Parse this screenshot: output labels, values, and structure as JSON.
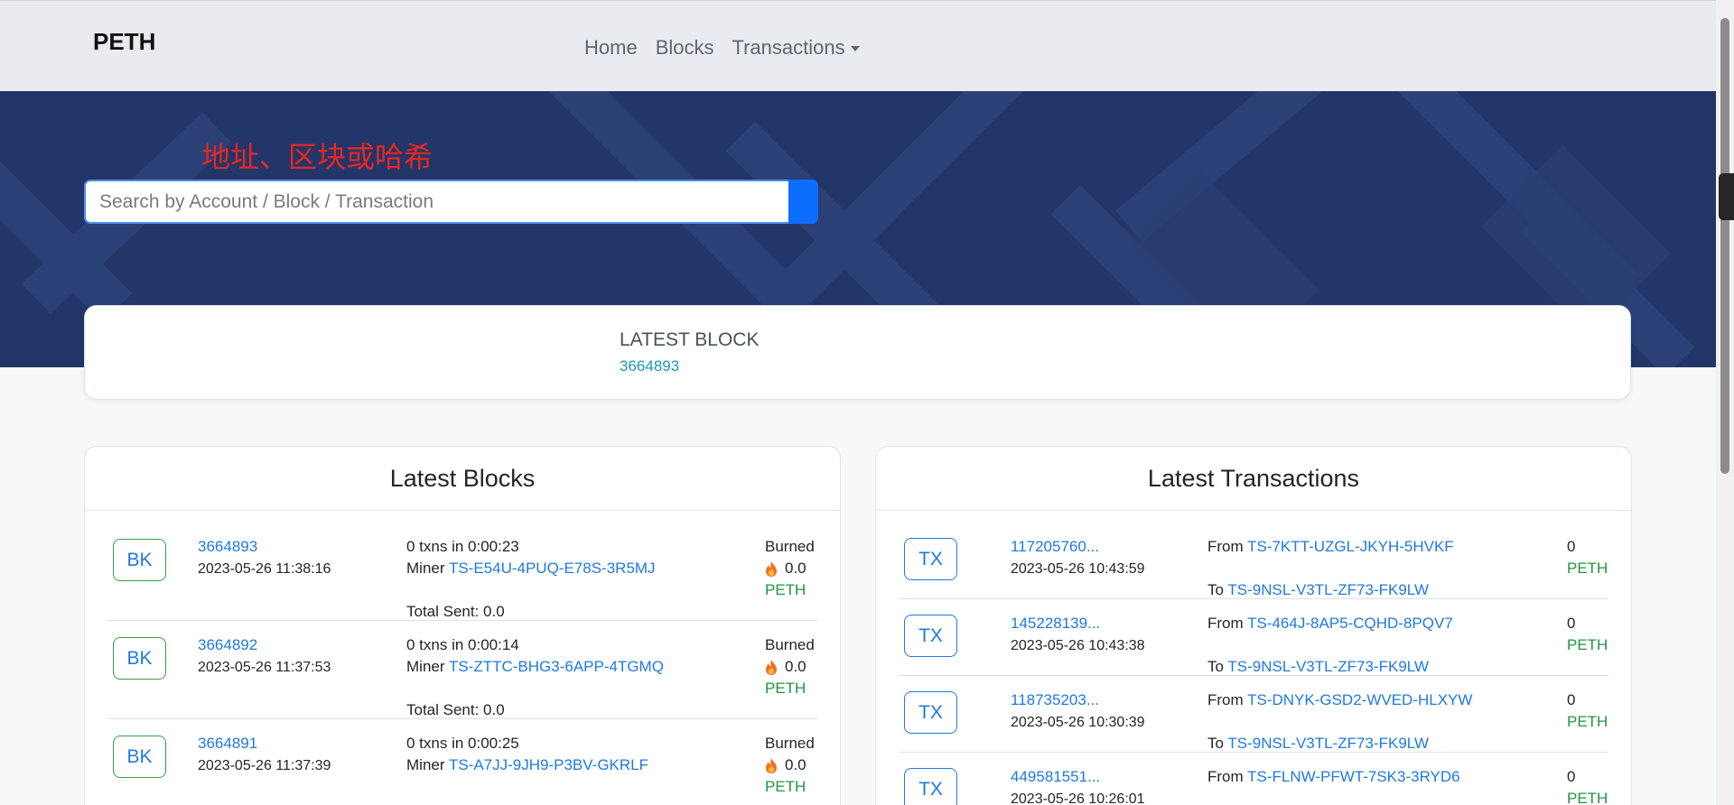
{
  "navbar": {
    "brand": "PETH",
    "links": [
      {
        "label": "Home"
      },
      {
        "label": "Blocks"
      },
      {
        "label": "Transactions"
      }
    ]
  },
  "hero": {
    "note": "地址、区块或哈希",
    "search_placeholder": "Search by Account / Block / Transaction"
  },
  "summary": {
    "label": "LATEST BLOCK",
    "value": "3664893"
  },
  "blocks_panel": {
    "title": "Latest Blocks",
    "badge": "BK",
    "burned_label": "Burned",
    "unit": "PETH",
    "miner_label": "Miner",
    "items": [
      {
        "number": "3664893",
        "time": "2023-05-26 11:38:16",
        "txns": "0 txns in 0:00:23",
        "miner": "TS-E54U-4PUQ-E78S-3R5MJ",
        "total_sent": "Total Sent: 0.0",
        "burned": "0.0"
      },
      {
        "number": "3664892",
        "time": "2023-05-26 11:37:53",
        "txns": "0 txns in 0:00:14",
        "miner": "TS-ZTTC-BHG3-6APP-4TGMQ",
        "total_sent": "Total Sent: 0.0",
        "burned": "0.0"
      },
      {
        "number": "3664891",
        "time": "2023-05-26 11:37:39",
        "txns": "0 txns in 0:00:25",
        "miner": "TS-A7JJ-9JH9-P3BV-GKRLF",
        "total_sent": "",
        "burned": "0.0"
      }
    ]
  },
  "tx_panel": {
    "title": "Latest Transactions",
    "badge": "TX",
    "from_label": "From",
    "to_label": "To",
    "unit": "PETH",
    "items": [
      {
        "hash": "117205760...",
        "time": "2023-05-26 10:43:59",
        "from": "TS-7KTT-UZGL-JKYH-5HVKF",
        "to": "TS-9NSL-V3TL-ZF73-FK9LW",
        "amount": "0"
      },
      {
        "hash": "145228139...",
        "time": "2023-05-26 10:43:38",
        "from": "TS-464J-8AP5-CQHD-8PQV7",
        "to": "TS-9NSL-V3TL-ZF73-FK9LW",
        "amount": "0"
      },
      {
        "hash": "118735203...",
        "time": "2023-05-26 10:30:39",
        "from": "TS-DNYK-GSD2-WVED-HLXYW",
        "to": "TS-9NSL-V3TL-ZF73-FK9LW",
        "amount": "0"
      },
      {
        "hash": "449581551...",
        "time": "2023-05-26 10:26:01",
        "from": "TS-FLNW-PFWT-7SK3-3RYD6",
        "to": "",
        "amount": "0"
      }
    ]
  },
  "colors": {
    "hero_bg": "#223669",
    "link": "#1e7ae0",
    "unit_green": "#22963f",
    "note_red": "#e8261f"
  }
}
